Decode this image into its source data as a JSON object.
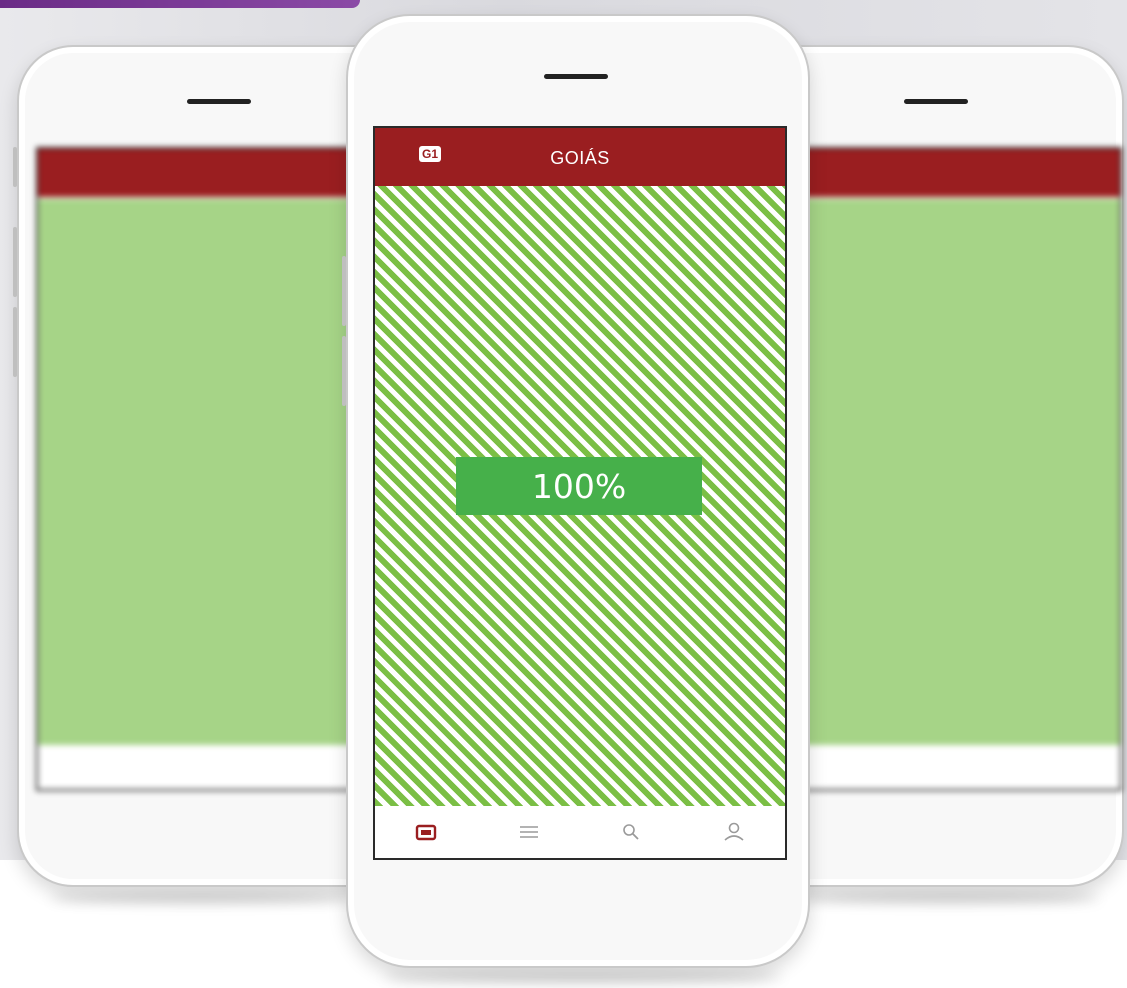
{
  "app": {
    "header_title": "GOIÁS",
    "brand_mark": "G1",
    "accent_color": "#9a1e20",
    "stripe_color": "#7bbf45",
    "progress_color": "#46b04a"
  },
  "progress": {
    "label": "100%",
    "value": 1.0
  },
  "tabbar": {
    "items": [
      {
        "icon": "news-icon",
        "active": true
      },
      {
        "icon": "menu-icon",
        "active": false
      },
      {
        "icon": "search-icon",
        "active": false
      },
      {
        "icon": "profile-icon",
        "active": false
      }
    ]
  }
}
